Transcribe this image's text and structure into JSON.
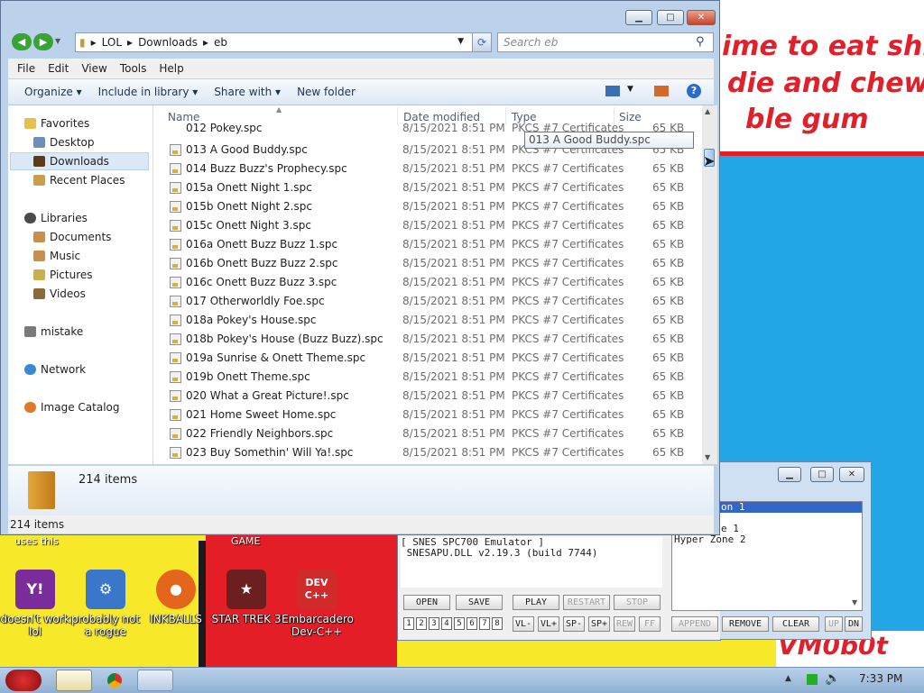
{
  "explorer": {
    "path": [
      "LOL",
      "Downloads",
      "eb"
    ],
    "search_placeholder": "Search eb",
    "menu": [
      "File",
      "Edit",
      "View",
      "Tools",
      "Help"
    ],
    "commands": [
      "Organize",
      "Include in library",
      "Share with",
      "New folder"
    ],
    "nav": {
      "favorites": "Favorites",
      "desktop": "Desktop",
      "downloads": "Downloads",
      "recent": "Recent Places",
      "libraries": "Libraries",
      "documents": "Documents",
      "music": "Music",
      "pictures": "Pictures",
      "videos": "Videos",
      "mistake": "mistake",
      "network": "Network",
      "image_catalog": "Image Catalog"
    },
    "columns": [
      "Name",
      "Date modified",
      "Type",
      "Size"
    ],
    "partial_top": {
      "name": "012 Pokey.spc",
      "date": "8/15/2021 8:51 PM",
      "type": "PKCS #7 Certificates",
      "size": "65 KB"
    },
    "files": [
      {
        "name": "013 A Good Buddy.spc",
        "date": "8/15/2021 8:51 PM",
        "type": "PKCS #7 Certificates",
        "size": "65 KB"
      },
      {
        "name": "014 Buzz Buzz's Prophecy.spc",
        "date": "8/15/2021 8:51 PM",
        "type": "PKCS #7 Certificates",
        "size": "65 KB"
      },
      {
        "name": "015a Onett Night 1.spc",
        "date": "8/15/2021 8:51 PM",
        "type": "PKCS #7 Certificates",
        "size": "65 KB"
      },
      {
        "name": "015b Onett Night 2.spc",
        "date": "8/15/2021 8:51 PM",
        "type": "PKCS #7 Certificates",
        "size": "65 KB"
      },
      {
        "name": "015c Onett Night 3.spc",
        "date": "8/15/2021 8:51 PM",
        "type": "PKCS #7 Certificates",
        "size": "65 KB"
      },
      {
        "name": "016a Onett Buzz Buzz 1.spc",
        "date": "8/15/2021 8:51 PM",
        "type": "PKCS #7 Certificates",
        "size": "65 KB"
      },
      {
        "name": "016b Onett Buzz Buzz 2.spc",
        "date": "8/15/2021 8:51 PM",
        "type": "PKCS #7 Certificates",
        "size": "65 KB"
      },
      {
        "name": "016c Onett Buzz Buzz 3.spc",
        "date": "8/15/2021 8:51 PM",
        "type": "PKCS #7 Certificates",
        "size": "65 KB"
      },
      {
        "name": "017 Otherworldly Foe.spc",
        "date": "8/15/2021 8:51 PM",
        "type": "PKCS #7 Certificates",
        "size": "65 KB"
      },
      {
        "name": "018a Pokey's House.spc",
        "date": "8/15/2021 8:51 PM",
        "type": "PKCS #7 Certificates",
        "size": "65 KB"
      },
      {
        "name": "018b Pokey's House (Buzz Buzz).spc",
        "date": "8/15/2021 8:51 PM",
        "type": "PKCS #7 Certificates",
        "size": "65 KB"
      },
      {
        "name": "019a Sunrise & Onett Theme.spc",
        "date": "8/15/2021 8:51 PM",
        "type": "PKCS #7 Certificates",
        "size": "65 KB"
      },
      {
        "name": "019b Onett Theme.spc",
        "date": "8/15/2021 8:51 PM",
        "type": "PKCS #7 Certificates",
        "size": "65 KB"
      },
      {
        "name": "020 What a Great Picture!.spc",
        "date": "8/15/2021 8:51 PM",
        "type": "PKCS #7 Certificates",
        "size": "65 KB"
      },
      {
        "name": "021 Home Sweet Home.spc",
        "date": "8/15/2021 8:51 PM",
        "type": "PKCS #7 Certificates",
        "size": "65 KB"
      },
      {
        "name": "022 Friendly Neighbors.spc",
        "date": "8/15/2021 8:51 PM",
        "type": "PKCS #7 Certificates",
        "size": "65 KB"
      },
      {
        "name": "023 Buy Somethin' Will Ya!.spc",
        "date": "8/15/2021 8:51 PM",
        "type": "PKCS #7 Certificates",
        "size": "65 KB"
      }
    ],
    "tooltip": "013 A Good Buddy.spc",
    "details_count": "214 items",
    "status": "214 items"
  },
  "desktop": {
    "meme_lines": [
      "ime to eat shit",
      "die and chew",
      "ble gum"
    ],
    "vm_text": "VM0b0t",
    "cut_labels": {
      "left": "uses this",
      "game": "GAME"
    },
    "icons": [
      {
        "label": "doesn't work lol",
        "color": "#7a2d9a",
        "glyph": "Y!"
      },
      {
        "label": "probably not a rogue",
        "color": "#3a76c9",
        "glyph": "⚙"
      },
      {
        "label": "INKBALLS",
        "color": "#e4651c",
        "glyph": "●"
      },
      {
        "label": "STAR TREK 3",
        "color": "#6b1f1f",
        "glyph": "★"
      },
      {
        "label": "Embarcadero Dev-C++",
        "color": "#d12a2a",
        "glyph": "DEV C++"
      }
    ]
  },
  "player": {
    "log_lines": [
      "[ SNES SPC700 Emulator ]",
      " SNESAPU.DLL v2.19.3 (build 7744)"
    ],
    "playlist": [
      "on 1",
      "e 1",
      "Hyper Zone 2"
    ],
    "buttons_row1": [
      "OPEN",
      "SAVE",
      "PLAY",
      "RESTART",
      "STOP"
    ],
    "channels": [
      "1",
      "2",
      "3",
      "4",
      "5",
      "6",
      "7",
      "8"
    ],
    "buttons_row2": [
      "VL-",
      "VL+",
      "SP-",
      "SP+",
      "REW",
      "FF",
      "APPEND",
      "REMOVE",
      "CLEAR",
      "UP",
      "DN"
    ]
  },
  "taskbar": {
    "time": "7:33 PM"
  }
}
